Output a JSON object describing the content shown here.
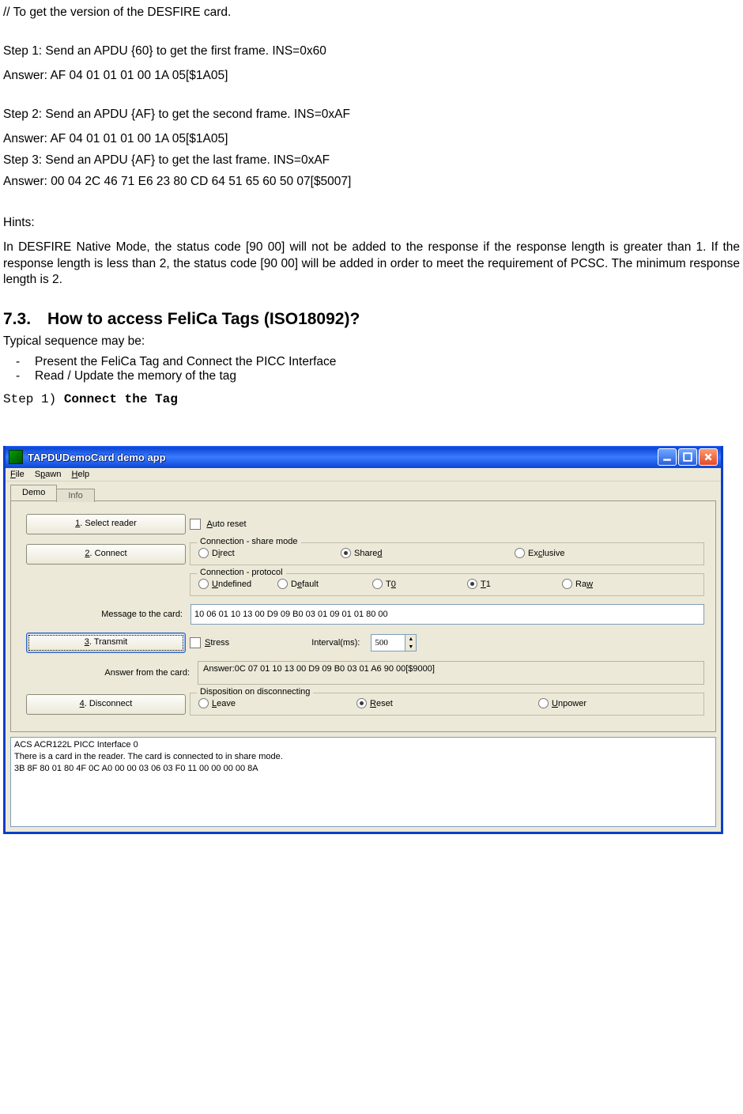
{
  "doc": {
    "comment": "// To get the version of the DESFIRE card.",
    "step1": "Step 1: Send an APDU {60} to get the first frame. INS=0x60",
    "ans1": "Answer: AF 04 01 01 01 00 1A 05[$1A05]",
    "step2": "Step 2: Send an APDU {AF} to get the second frame. INS=0xAF",
    "ans2": "Answer: AF 04 01 01 01 00 1A 05[$1A05]",
    "step3": "Step 3: Send an APDU {AF} to get the last frame. INS=0xAF",
    "ans3": "Answer: 00 04 2C 46 71 E6 23 80 CD 64 51 65 60 50 07[$5007]",
    "hints_label": "Hints:",
    "hints_body": "In DESFIRE Native Mode, the status code [90 00] will not be added to the response if the response length is greater than 1. If the response length is less than 2, the status code [90 00] will be added in order to meet the requirement of PCSC. The minimum response length is 2.",
    "sec_heading": "7.3. How to access FeliCa Tags (ISO18092)?",
    "seq_intro": "Typical sequence may be:",
    "seq1": "Present the FeliCa Tag and Connect the PICC Interface",
    "seq2": "Read / Update the memory of the tag",
    "step1_label_pre": "Step 1) ",
    "step1_label_bold": "Connect the Tag"
  },
  "win": {
    "title": "TAPDUDemoCard demo app",
    "menu": {
      "file": "File",
      "spawn": "Spawn",
      "help": "Help"
    },
    "tabs": {
      "demo": "Demo",
      "info": "Info"
    },
    "buttons": {
      "select_reader": "1. Select reader",
      "connect": "2. Connect",
      "transmit": "3. Transmit",
      "disconnect": "4. Disconnect"
    },
    "labels": {
      "auto_reset": "Auto reset",
      "share_legend": "Connection - share mode",
      "direct": "Direct",
      "shared": "Shared",
      "exclusive": "Exclusive",
      "proto_legend": "Connection - protocol",
      "undefined": "Undefined",
      "default": "Default",
      "t0": "T0",
      "t1": "T1",
      "raw": "Raw",
      "msg_to_card": "Message to the card:",
      "stress": "Stress",
      "interval": "Interval(ms):",
      "answer_from_card": "Answer from the card:",
      "disp_legend": "Disposition on disconnecting",
      "leave": "Leave",
      "reset": "Reset",
      "unpower": "Unpower"
    },
    "values": {
      "msg": "10 06 01 10 13 00 D9 09 B0 03 01 09 01 01 80 00",
      "interval": "500",
      "answer": "Answer:0C 07 01 10 13 00 D9 09 B0 03 01 A6 90 00[$9000]"
    },
    "log": {
      "l1": "ACS ACR122L PICC Interface 0",
      "l2": "There is a card in the reader. The card is connected to in share mode.",
      "l3": "3B 8F 80 01 80 4F 0C A0 00 00 03 06 03 F0 11 00 00 00 00 8A"
    }
  }
}
